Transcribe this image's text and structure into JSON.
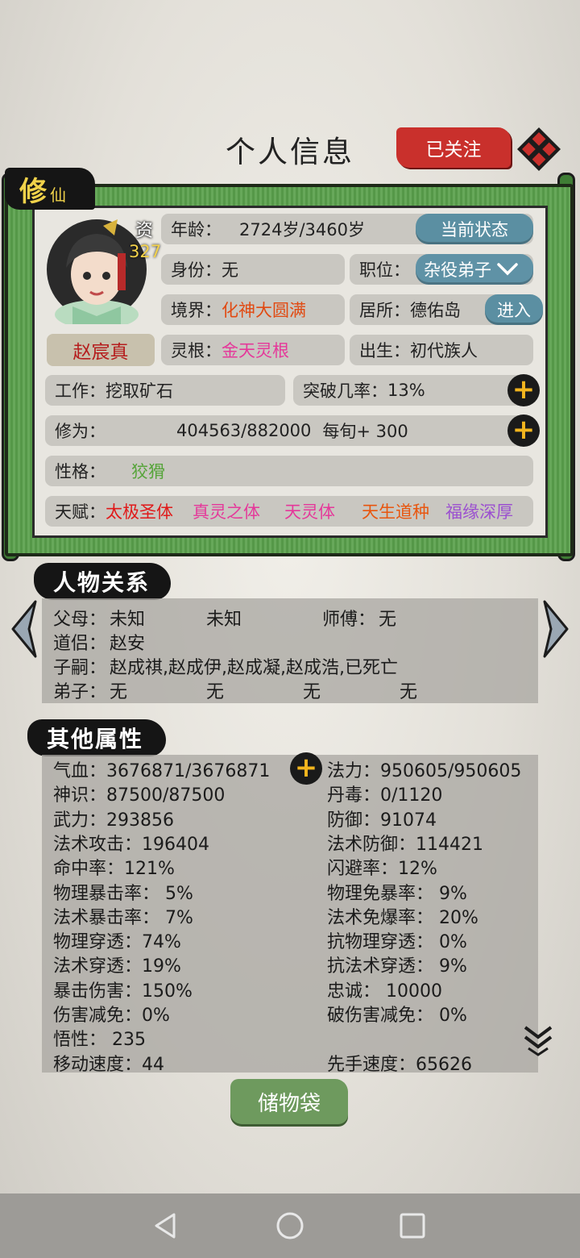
{
  "header": {
    "title": "个人信息",
    "follow_label": "已关注"
  },
  "character": {
    "badge_big": "修",
    "badge_small": "仙",
    "aptitude_label": "资",
    "aptitude_value": "327",
    "name": "赵宸真",
    "age_label": "年龄：",
    "age_value": "2724岁/3460岁",
    "status_button": "当前状态",
    "identity_label": "身份：",
    "identity_value": "无",
    "position_label": "职位：",
    "position_value": "杂役弟子",
    "realm_label": "境界：",
    "realm_value": "化神大圆满",
    "residence_label": "居所：",
    "residence_value": "德佑岛",
    "enter_button": "进入",
    "root_label": "灵根：",
    "root_value": "金天灵根",
    "birth_label": "出生：",
    "birth_value": "初代族人",
    "work_label": "工作：",
    "work_value": "挖取矿石",
    "breakthrough_label": "突破几率：",
    "breakthrough_value": "13%",
    "cultivation_label": "修为：",
    "cultivation_value": "404563/882000",
    "cultivation_rate": "每旬+ 300",
    "personality_label": "性格：",
    "personality_value": "狡猾",
    "talent_label": "天赋：",
    "talents": [
      {
        "name": "太极圣体",
        "color": "#e01a1a"
      },
      {
        "name": "真灵之体",
        "color": "#e5389a"
      },
      {
        "name": "天灵体",
        "color": "#e5389a"
      },
      {
        "name": "天生道种",
        "color": "#e8560f"
      },
      {
        "name": "福缘深厚",
        "color": "#9b4fd0"
      }
    ]
  },
  "relations": {
    "title": "人物关系",
    "parents_label": "父母：",
    "parent1": "未知",
    "parent2": "未知",
    "master_label": "师傅：",
    "master_value": "无",
    "partner_label": "道侣：",
    "partner_value": "赵安",
    "children_label": "子嗣：",
    "children_value": "赵成祺,赵成伊,赵成凝,赵成浩,已死亡",
    "disciples_label": "弟子：",
    "disciple1": "无",
    "disciple2": "无",
    "disciple3": "无",
    "disciple4": "无"
  },
  "attributes": {
    "title": "其他属性",
    "left": [
      "气血：3676871/3676871",
      "神识：87500/87500",
      "武力：293856",
      "法术攻击：196404",
      "命中率：121%",
      "物理暴击率： 5%",
      "法术暴击率： 7%",
      "物理穿透：74%",
      "法术穿透：19%",
      "暴击伤害：150%",
      "伤害减免：0%",
      "悟性： 235",
      "移动速度：44"
    ],
    "right": [
      "法力：950605/950605",
      "丹毒：0/1120",
      "防御：91074",
      "法术防御：114421",
      "闪避率：12%",
      "物理免暴率： 9%",
      "法术免爆率： 20%",
      "抗物理穿透： 0%",
      "抗法术穿透： 9%",
      "忠诚： 10000",
      "破伤害减免： 0%",
      "",
      "先手速度：65626"
    ]
  },
  "footer": {
    "bag_button": "储物袋"
  },
  "icons": [
    "close-icon",
    "plus-icon",
    "chevron-down-icon",
    "arrow-left-icon",
    "arrow-right-icon",
    "double-chevron-down-icon",
    "back-icon",
    "home-icon",
    "recents-icon"
  ]
}
